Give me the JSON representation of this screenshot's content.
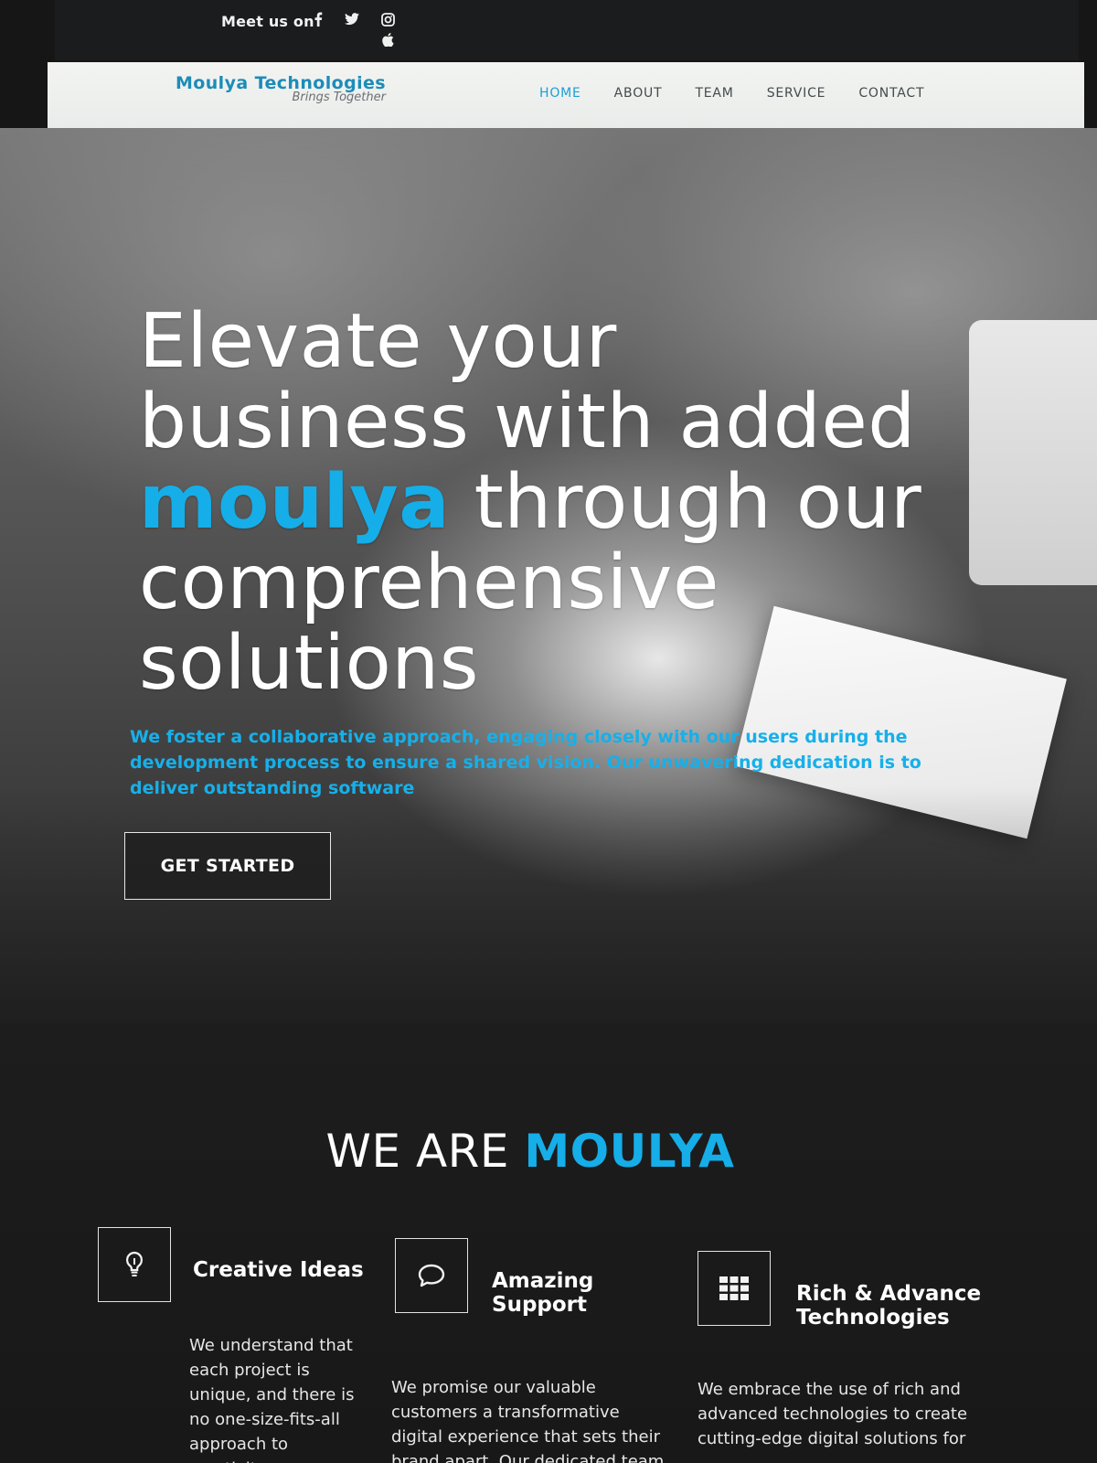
{
  "topbar": {
    "meet_label": "Meet us on",
    "social_icons": [
      "facebook-icon",
      "twitter-icon",
      "instagram-icon",
      "apple-icon"
    ]
  },
  "nav": {
    "brand_name": "Moulya Technologies",
    "brand_tagline": "Brings Together",
    "items": [
      {
        "label": "HOME",
        "active": true
      },
      {
        "label": "ABOUT",
        "active": false
      },
      {
        "label": "TEAM",
        "active": false
      },
      {
        "label": "SERVICE",
        "active": false
      },
      {
        "label": "CONTACT",
        "active": false
      }
    ]
  },
  "hero": {
    "title_before": "Elevate your business with added ",
    "title_accent": "moulya",
    "title_after": " through our comprehensive solutions",
    "description": "We foster a collaborative approach, engaging closely with our users during the development process to ensure a shared vision. Our unwavering dedication is to deliver outstanding software",
    "cta_label": "GET STARTED"
  },
  "about": {
    "title_prefix": "WE ARE ",
    "title_accent": "MOULYA",
    "features": [
      {
        "icon": "lightbulb-icon",
        "title": "Creative Ideas",
        "description": "We understand that each project is unique, and there is no one-size-fits-all approach to creativity."
      },
      {
        "icon": "chat-bubble-icon",
        "title": "Amazing Support",
        "description": "We promise our valuable customers a transformative digital experience that sets their brand apart. Our dedicated team of"
      },
      {
        "icon": "grid-icon",
        "title": "Rich & Advance Technologies",
        "description": "We embrace the use of rich and advanced technologies to create cutting-edge digital solutions for"
      }
    ]
  },
  "colors": {
    "accent": "#15aee8",
    "brand": "#1d8cb8",
    "nav_active": "#1aa0d6",
    "dark_bg": "#1b1c1d"
  }
}
